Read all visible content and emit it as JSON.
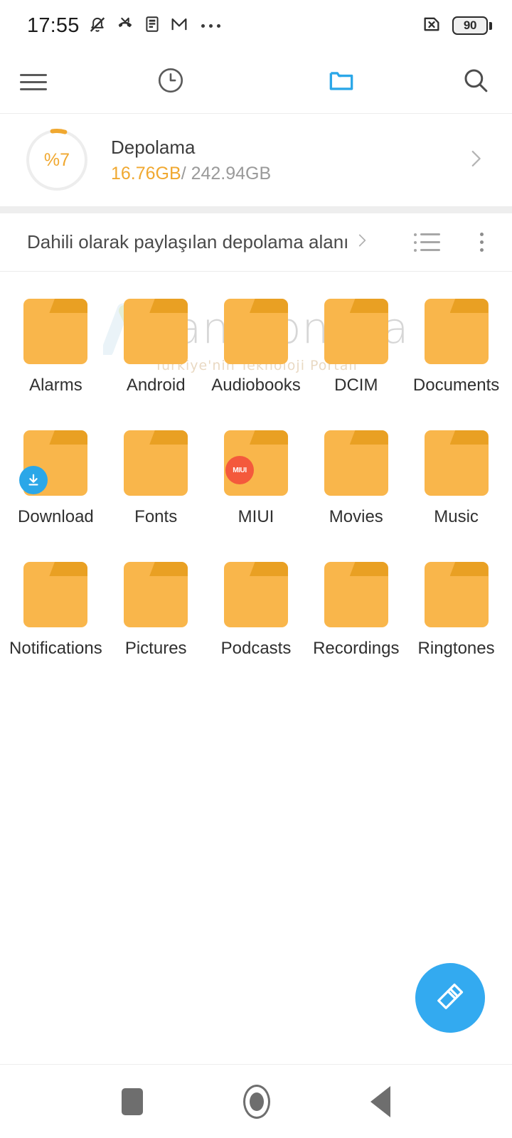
{
  "status_bar": {
    "time": "17:55",
    "left_icons": [
      "bell-muted-icon",
      "missed-call-icon",
      "note-icon",
      "gmail-icon",
      "more-dots-icon"
    ],
    "battery_level": "90",
    "sim_icon": "sim-error-icon"
  },
  "toolbar": {
    "menu_icon": "hamburger-menu-icon",
    "recent_icon": "clock-recent-icon",
    "folder_icon": "folder-tab-icon",
    "search_icon": "search-icon",
    "active_tab": "folder-tab-icon",
    "accent_color": "#2BA7E8"
  },
  "storage": {
    "percent_label": "%7",
    "percent_value": 7,
    "title": "Depolama",
    "used": "16.76GB",
    "separator": "/ ",
    "total": "242.94GB",
    "used_color": "#F0A830",
    "chevron_icon": "chevron-right-icon"
  },
  "breadcrumb": {
    "path_label": "Dahili olarak paylaşılan depolama alanı",
    "chevron_icon": "chevron-right-icon",
    "view_toggle_icon": "list-view-icon",
    "overflow_icon": "overflow-menu-icon"
  },
  "watermark": {
    "text": "andronova",
    "subtitle": "Türkiye'nin Teknoloji Portalı"
  },
  "folders": [
    {
      "label": "Alarms",
      "badge": "none"
    },
    {
      "label": "Android",
      "badge": "none"
    },
    {
      "label": "Audiobooks",
      "badge": "none"
    },
    {
      "label": "DCIM",
      "badge": "none"
    },
    {
      "label": "Documents",
      "badge": "none"
    },
    {
      "label": "Download",
      "badge": "download",
      "badge_icon": "download-badge-icon"
    },
    {
      "label": "Fonts",
      "badge": "none"
    },
    {
      "label": "MIUI",
      "badge": "miui",
      "badge_text": "MIUI"
    },
    {
      "label": "Movies",
      "badge": "none"
    },
    {
      "label": "Music",
      "badge": "none"
    },
    {
      "label": "Notifications",
      "badge": "none"
    },
    {
      "label": "Pictures",
      "badge": "none"
    },
    {
      "label": "Podcasts",
      "badge": "none"
    },
    {
      "label": "Recordings",
      "badge": "none"
    },
    {
      "label": "Ringtones",
      "badge": "none"
    }
  ],
  "fab": {
    "icon": "cleaner-brush-icon",
    "color": "#33AAF0"
  },
  "navigation_bar": {
    "recents_icon": "recents-square-icon",
    "home_icon": "home-circle-icon",
    "back_icon": "back-triangle-icon"
  },
  "theme": {
    "folder_color": "#F9B64B",
    "folder_tab_color": "#E9A023",
    "accent_blue": "#2BA7E8",
    "text_primary": "#303030"
  }
}
